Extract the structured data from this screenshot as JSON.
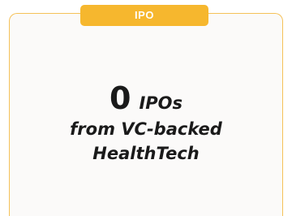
{
  "badge": {
    "label": "IPO",
    "color": "#f6b72e"
  },
  "stat": {
    "value": "0",
    "unit": "IPOs",
    "description_line1": "from VC-backed",
    "description_line2": "HealthTech"
  },
  "colors": {
    "card_border": "#f5c158",
    "card_background": "#fbfaf9",
    "text": "#1a1a1a"
  }
}
